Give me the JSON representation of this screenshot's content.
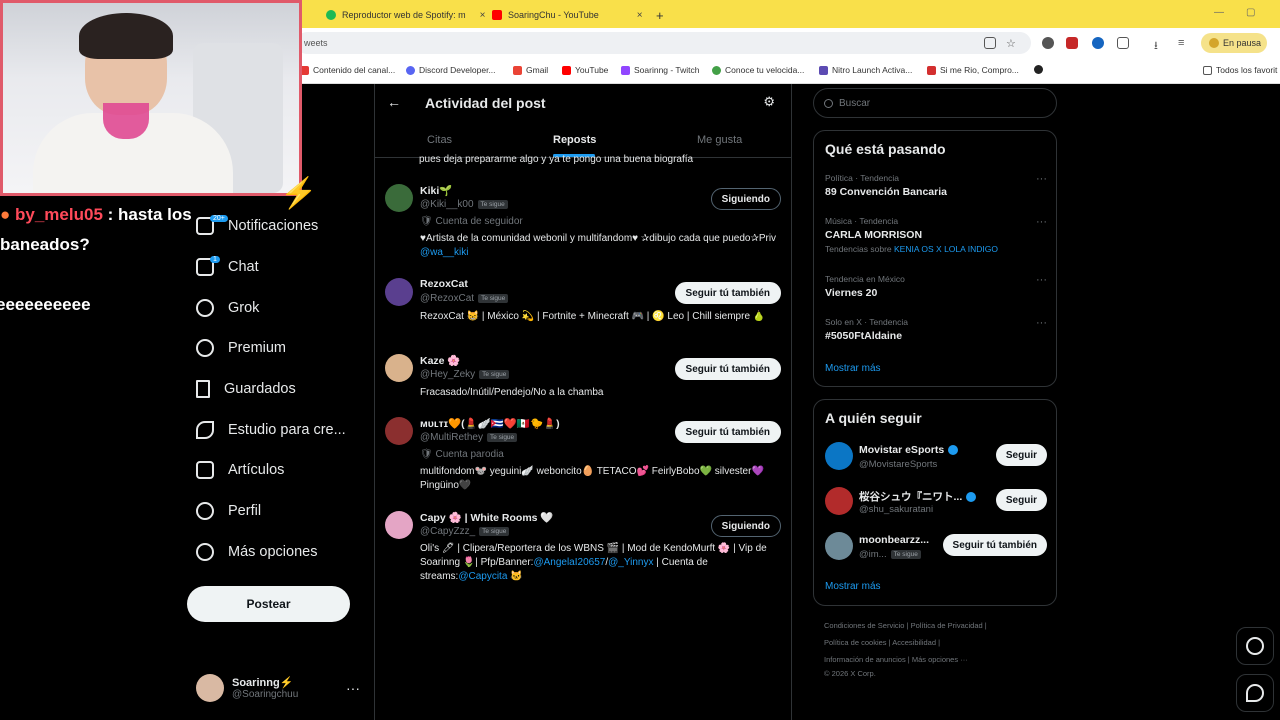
{
  "browser": {
    "tabs": [
      {
        "label": "Reproductor web de Spotify: m",
        "color": "#1db954"
      },
      {
        "label": "SoaringChu - YouTube",
        "color": "#ff0000"
      }
    ],
    "new_tab": "+",
    "omnibox_text": "weets",
    "pause_label": "En pausa",
    "bookmarks": [
      {
        "label": "Contenido del canal...",
        "color": "#e53935"
      },
      {
        "label": "Discord Developer...",
        "color": "#5865f2"
      },
      {
        "label": "Gmail",
        "color": "#ea4335"
      },
      {
        "label": "YouTube",
        "color": "#ff0000"
      },
      {
        "label": "Soarinng - Twitch",
        "color": "#9146ff"
      },
      {
        "label": "Conoce tu velocida...",
        "color": "#43a047"
      },
      {
        "label": "Nitro Launch Activa...",
        "color": "#5c4bb3"
      },
      {
        "label": "Si me Rio, Compro...",
        "color": "#d32f2f"
      }
    ],
    "all_favorites": "Todos los favorit"
  },
  "stream": {
    "chat_user": "by_melu05",
    "chat_line1": " : hasta los",
    "chat_line2": "baneados?",
    "chat_line3": "eeeeeeeeee"
  },
  "nav": {
    "items": [
      {
        "label": "Notificaciones",
        "badge": "20+"
      },
      {
        "label": "Chat",
        "badge": "1"
      },
      {
        "label": "Grok"
      },
      {
        "label": "Premium"
      },
      {
        "label": "Guardados"
      },
      {
        "label": "Estudio para cre..."
      },
      {
        "label": "Artículos"
      },
      {
        "label": "Perfil"
      },
      {
        "label": "Más opciones"
      }
    ],
    "post_button": "Postear",
    "account": {
      "name": "Soarinng⚡",
      "handle": "@Soaringchuu",
      "more": "···"
    }
  },
  "center": {
    "back": "←",
    "title": "Actividad del post",
    "tabs": [
      "Citas",
      "Reposts",
      "Me gusta"
    ],
    "cut_text": "pues deja prepararme algo y ya te pongo una buena biografía",
    "users": [
      {
        "name": "Kiki🌱",
        "handle": "@Kiki__k00",
        "follows_you": "Te sigue",
        "sub": "🛡 Cuenta de seguidor",
        "bio": "♥Artista de la comunidad webonil y multifandom♥ ✰dibujo cada que puedo✰Priv ",
        "bio_link": "@wa__kiki",
        "button": "Siguiendo",
        "avatar_color": "#3a6b3a"
      },
      {
        "name": "RezoxCat",
        "handle": "@RezoxCat",
        "follows_you": "Te sigue",
        "bio": "RezoxCat 😸 | México 💫 | Fortnite + Minecraft 🎮 | ♌ Leo | Chill siempre 🍐",
        "button": "Seguir tú también",
        "avatar_color": "#5a3f8f"
      },
      {
        "name": "Kaze 🌸",
        "handle": "@Hey_Zeky",
        "follows_you": "Te sigue",
        "bio": "Fracasado/Inútil/Pendejo/No a la chamba",
        "button": "Seguir tú también",
        "avatar_color": "#d9b28c"
      },
      {
        "name": "ᴍᴜʟᴛɪ🧡(💄🪽🇨🇺❤️🇲🇽🐤💄)",
        "handle": "@MultiRethey",
        "follows_you": "Te sigue",
        "sub": "🛡 Cuenta parodia",
        "bio": "multifondom🐭 yeguini🪽 weboncito🥚 TETACO💕 FeirlyBobo💚 silvester💜 Pingüino🖤",
        "button": "Seguir tú también",
        "avatar_color": "#8b2f2f"
      },
      {
        "name": "Capy 🌸 | White Rooms 🤍",
        "handle": "@CapyZzz_",
        "follows_you": "Te sigue",
        "bio": "Oli's 🖊 | Clipera/Reportera de los WBNS 🎬 | Mod de KendoMurft 🌸 | Vip de Soarinng 🌷| Pfp/Banner:",
        "bio_links": [
          "@AngelaI20657",
          "@_Yinnyx"
        ],
        "bio_mid": "/",
        "bio_tail": " | Cuenta de streams:",
        "bio_link2": "@Capycita",
        "bio_end": " 🐱",
        "button": "Siguiendo",
        "avatar_color": "#e4a5c5"
      }
    ]
  },
  "right": {
    "search_placeholder": "Buscar",
    "trending_title": "Qué está pasando",
    "trends": [
      {
        "context": "Política · Tendencia",
        "title": "89 Convención Bancaria",
        "extra": ""
      },
      {
        "context": "Música · Tendencia",
        "title": "CARLA MORRISON",
        "extra_prefix": "Tendencias sobre ",
        "extra_link": "KENIA OS X LOLA INDIGO"
      },
      {
        "context": "Tendencia en México",
        "title": "Viernes 20",
        "extra": ""
      },
      {
        "context": "Solo en X · Tendencia",
        "title": "#5050FtAldaine",
        "extra": ""
      }
    ],
    "show_more": "Mostrar más",
    "who_title": "A quién seguir",
    "who": [
      {
        "name": "Movistar eSports",
        "handle": "@MovistareSports",
        "button": "Seguir",
        "avatar_color": "#0b76c5"
      },
      {
        "name": "桜谷シュウ『ニワト...",
        "handle": "@shu_sakuratani",
        "button": "Seguir",
        "avatar_color": "#b22b2b"
      },
      {
        "name": "moonbearzz...",
        "handle": "@im...",
        "follows_you": "Te sigue",
        "button": "Seguir tú también",
        "avatar_color": "#6d8a98"
      }
    ],
    "show_more2": "Mostrar más",
    "footer": {
      "line1": "Condiciones de Servicio  |  Política de Privacidad  |",
      "line2": "Política de cookies  |  Accesibilidad  |",
      "line3": "Información de anuncios  |  Más opciones ···",
      "line4": "© 2026 X Corp."
    }
  }
}
